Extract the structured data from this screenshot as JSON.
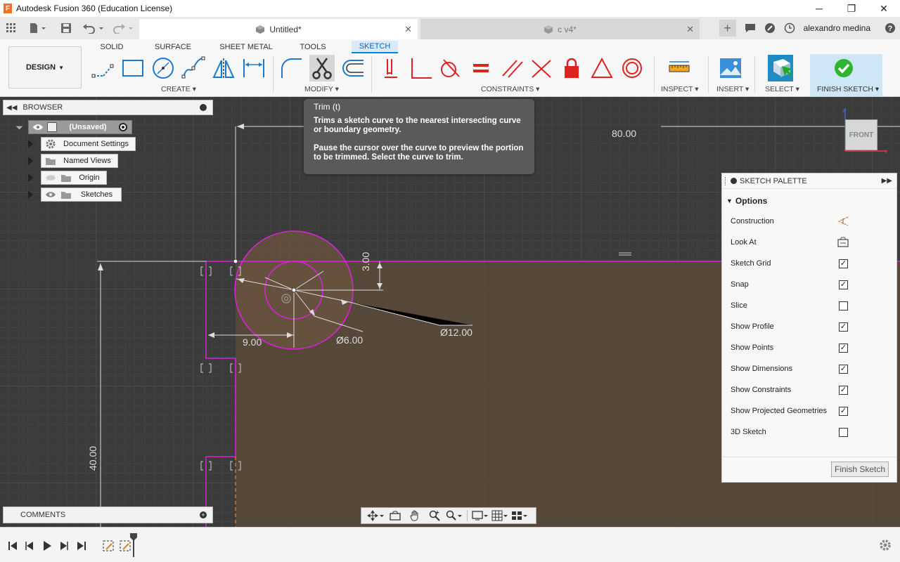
{
  "window": {
    "title": "Autodesk Fusion 360 (Education License)",
    "minimize": "─",
    "maximize": "❐",
    "close": "✕"
  },
  "tabs": [
    {
      "label": "Untitled*",
      "active": true
    },
    {
      "label": "c v4*",
      "active": false
    }
  ],
  "user": {
    "name": "alexandro medina"
  },
  "ribbon": {
    "workspace": "DESIGN",
    "tabs": [
      "SOLID",
      "SURFACE",
      "SHEET METAL",
      "TOOLS",
      "SKETCH"
    ],
    "active_tab": "SKETCH",
    "groups": {
      "create": "CREATE",
      "modify": "MODIFY",
      "constraints": "CONSTRAINTS",
      "inspect": "INSPECT",
      "insert": "INSERT",
      "select": "SELECT",
      "finish": "FINISH SKETCH"
    }
  },
  "browser": {
    "title": "BROWSER",
    "root": "(Unsaved)",
    "items": [
      "Document Settings",
      "Named Views",
      "Origin",
      "Sketches"
    ]
  },
  "comments": {
    "title": "COMMENTS"
  },
  "tooltip": {
    "title": "Trim (t)",
    "line1": "Trims a sketch curve to the nearest intersecting curve or boundary geometry.",
    "line2": "Pause the cursor over the curve to preview the portion to be trimmed. Select the curve to trim."
  },
  "viewcube": {
    "face": "FRONT"
  },
  "sketch": {
    "dimensions": {
      "top": "80.00",
      "offset_y": "3.00",
      "offset_x": "9.00",
      "inner_dia": "Ø6.00",
      "outer_dia": "Ø12.00",
      "height": "40.00"
    },
    "colors": {
      "profile_fill": "#5a4a3a",
      "line": "#e020e0",
      "dim": "#ffffff",
      "centerline": "#e07020"
    }
  },
  "palette": {
    "title": "SKETCH PALETTE",
    "section": "Options",
    "rows": [
      {
        "label": "Construction",
        "type": "icon",
        "icon": "construction-icon"
      },
      {
        "label": "Look At",
        "type": "icon",
        "icon": "look-at-icon"
      },
      {
        "label": "Sketch Grid",
        "type": "checkbox",
        "checked": true
      },
      {
        "label": "Snap",
        "type": "checkbox",
        "checked": true
      },
      {
        "label": "Slice",
        "type": "checkbox",
        "checked": false
      },
      {
        "label": "Show Profile",
        "type": "checkbox",
        "checked": true
      },
      {
        "label": "Show Points",
        "type": "checkbox",
        "checked": true
      },
      {
        "label": "Show Dimensions",
        "type": "checkbox",
        "checked": true
      },
      {
        "label": "Show Constraints",
        "type": "checkbox",
        "checked": true
      },
      {
        "label": "Show Projected Geometries",
        "type": "checkbox",
        "checked": true
      },
      {
        "label": "3D Sketch",
        "type": "checkbox",
        "checked": false
      }
    ],
    "finish_button": "Finish Sketch"
  }
}
